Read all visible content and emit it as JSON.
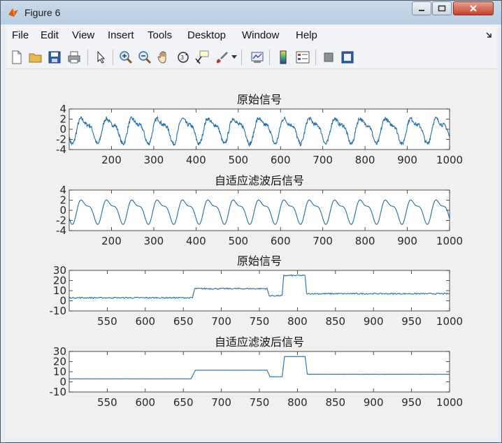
{
  "window": {
    "title": "Figure 6",
    "colors": {
      "titlebar": "#c3d5e8",
      "figure_bg": "#f0f0f0",
      "line": "#1f6fa8"
    }
  },
  "menu": {
    "items": [
      {
        "label": "File"
      },
      {
        "label": "Edit"
      },
      {
        "label": "View"
      },
      {
        "label": "Insert"
      },
      {
        "label": "Tools"
      },
      {
        "label": "Desktop"
      },
      {
        "label": "Window"
      },
      {
        "label": "Help"
      }
    ]
  },
  "toolbar": {
    "icons": [
      "new-figure-icon",
      "open-file-icon",
      "save-icon",
      "print-icon",
      "pointer-icon",
      "zoom-in-icon",
      "zoom-out-icon",
      "pan-icon",
      "rotate-3d-icon",
      "data-cursor-icon",
      "brush-icon",
      "link-plot-icon",
      "colorbar-icon",
      "legend-icon",
      "hide-plot-tools-icon",
      "show-plot-tools-icon"
    ]
  },
  "chart_data": [
    {
      "type": "line",
      "title": "原始信号",
      "xlim": [
        100,
        1000
      ],
      "ylim": [
        -4,
        4
      ],
      "xticks": [
        200,
        300,
        400,
        500,
        600,
        700,
        800,
        900,
        1000
      ],
      "yticks": [
        -4,
        -2,
        0,
        2,
        4
      ],
      "grid": false,
      "series": [
        {
          "period": 60,
          "amplitude": 2.5,
          "noise": 0.5
        }
      ]
    },
    {
      "type": "line",
      "title": "自适应滤波后信号",
      "xlim": [
        100,
        1000
      ],
      "ylim": [
        -4,
        4
      ],
      "xticks": [
        200,
        300,
        400,
        500,
        600,
        700,
        800,
        900,
        1000
      ],
      "yticks": [
        -4,
        -2,
        0,
        2,
        4
      ],
      "grid": false,
      "series": [
        {
          "period": 60,
          "amplitude": 2.4,
          "noise": 0
        }
      ]
    },
    {
      "type": "line",
      "title": "原始信号",
      "xlim": [
        500,
        1000
      ],
      "ylim": [
        -10,
        30
      ],
      "xticks": [
        550,
        600,
        650,
        700,
        750,
        800,
        850,
        900,
        950,
        1000
      ],
      "yticks": [
        -10,
        0,
        10,
        20,
        30
      ],
      "grid": false,
      "series": [
        {
          "steps": [
            [
              500,
              3
            ],
            [
              662,
              3
            ],
            [
              665,
              12
            ],
            [
              760,
              12
            ],
            [
              763,
              5
            ],
            [
              780,
              5
            ],
            [
              782,
              25
            ],
            [
              810,
              25
            ],
            [
              812,
              7
            ],
            [
              1000,
              7
            ]
          ],
          "noise": 0.6
        }
      ]
    },
    {
      "type": "line",
      "title": "自适应滤波后信号",
      "xlim": [
        500,
        1000
      ],
      "ylim": [
        -10,
        30
      ],
      "xticks": [
        550,
        600,
        650,
        700,
        750,
        800,
        850,
        900,
        950,
        1000
      ],
      "yticks": [
        -10,
        0,
        10,
        20,
        30
      ],
      "grid": false,
      "series": [
        {
          "steps": [
            [
              500,
              3
            ],
            [
              660,
              3
            ],
            [
              666,
              11.5
            ],
            [
              760,
              11.5
            ],
            [
              764,
              5
            ],
            [
              780,
              5
            ],
            [
              783,
              25
            ],
            [
              810,
              25
            ],
            [
              813,
              7.5
            ],
            [
              1000,
              7.5
            ]
          ],
          "noise": 0.05
        }
      ]
    }
  ]
}
